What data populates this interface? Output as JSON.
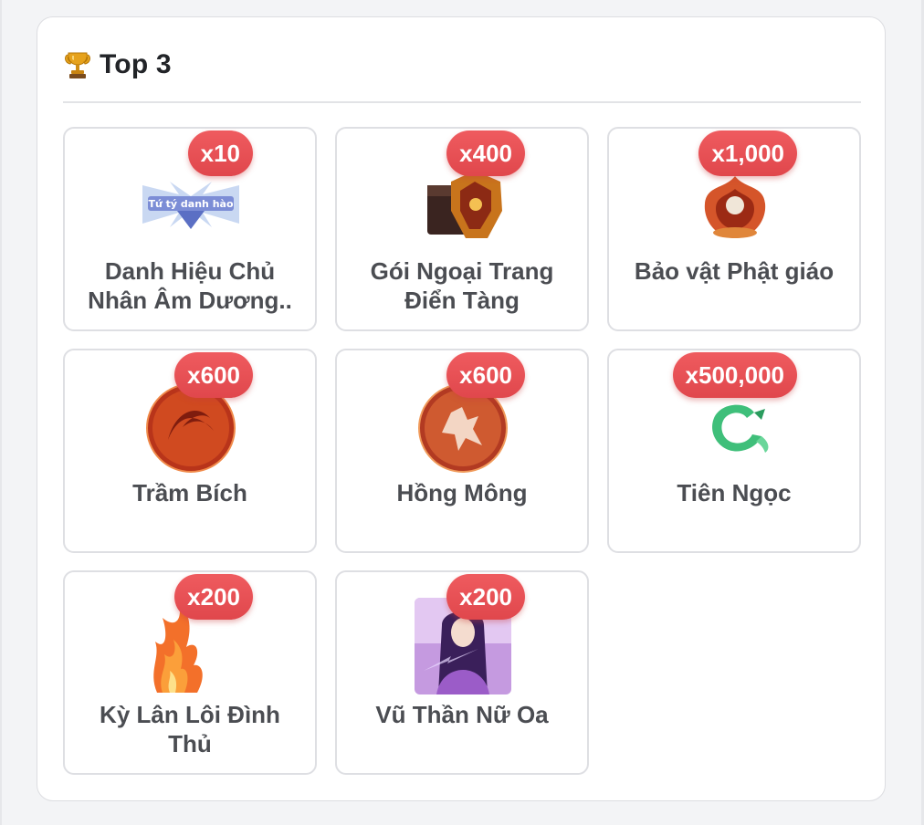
{
  "header": {
    "icon": "trophy-icon",
    "title": "Top 3"
  },
  "colors": {
    "badge": "#e84c50",
    "title": "#222428",
    "item_name": "#4b4d52",
    "card_border": "#dedfe3"
  },
  "items": [
    {
      "name": "Danh Hiệu Chủ Nhân Âm Dương..",
      "quantity": "x10",
      "image": "title-banner-image"
    },
    {
      "name": "Gói Ngoại Trang Điển Tàng",
      "quantity": "x400",
      "image": "costume-chest-image"
    },
    {
      "name": "Bảo vật Phật giáo",
      "quantity": "x1,000",
      "image": "buddhist-treasure-image"
    },
    {
      "name": "Trầm Bích",
      "quantity": "x600",
      "image": "red-coin-image"
    },
    {
      "name": "Hồng Mông",
      "quantity": "x600",
      "image": "red-coin-warrior-image"
    },
    {
      "name": "Tiên Ngọc",
      "quantity": "x500,000",
      "image": "jade-dragon-image"
    },
    {
      "name": "Kỳ Lân Lôi Đình Thủ",
      "quantity": "x200",
      "image": "fire-effect-image"
    },
    {
      "name": "Vũ Thần Nữ Oa",
      "quantity": "x200",
      "image": "goddess-portrait-image"
    }
  ]
}
